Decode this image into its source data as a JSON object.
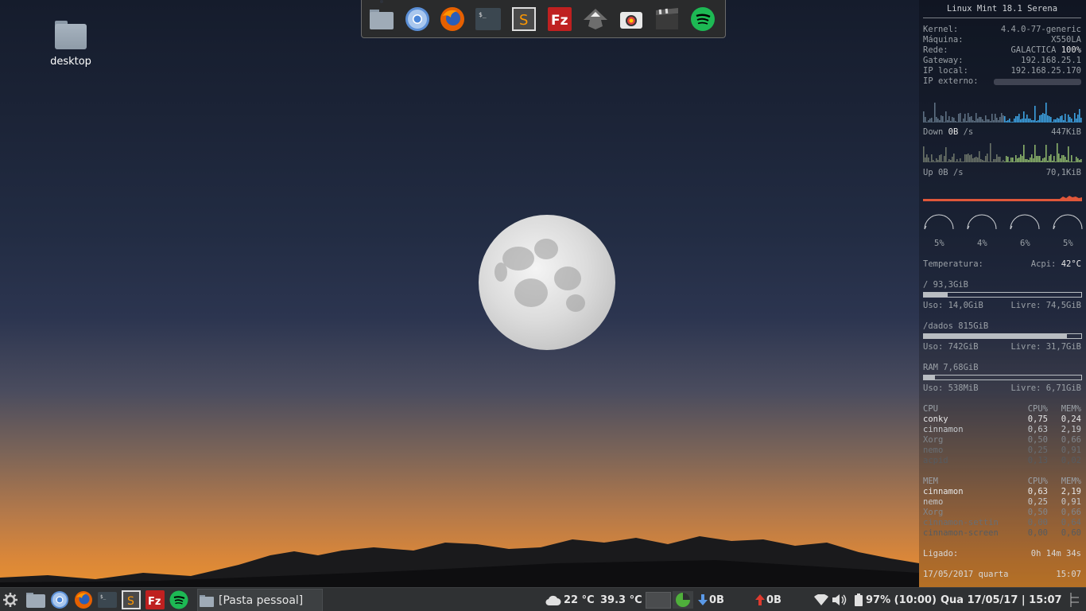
{
  "desktop": {
    "icon_label": "desktop"
  },
  "dock": {
    "items": [
      "files-icon",
      "chromium-icon",
      "firefox-icon",
      "terminal-icon",
      "sublime-text-icon",
      "filezilla-icon",
      "inkscape-icon",
      "screenshot-icon",
      "video-editor-icon",
      "spotify-icon"
    ]
  },
  "conky": {
    "title": "Linux Mint 18.1 Serena",
    "system": [
      {
        "label": "Kernel:",
        "value": "4.4.0-77-generic"
      },
      {
        "label": "Máquina:",
        "value": "X550LA"
      },
      {
        "label": "Rede:",
        "value": "GALACTICA",
        "extra": "100%"
      },
      {
        "label": "Gateway:",
        "value": "192.168.25.1"
      },
      {
        "label": "IP local:",
        "value": "192.168.25.170"
      },
      {
        "label": "IP externo:",
        "value": ""
      }
    ],
    "down": {
      "label": "Down",
      "value": "0B",
      "unit": "/s",
      "max": "447KiB"
    },
    "up": {
      "label": "Up",
      "value": "0B",
      "unit": "/s",
      "max": "70,1KiB"
    },
    "cpu_gauges": [
      "5%",
      "4%",
      "6%",
      "5%"
    ],
    "temperature": {
      "label": "Temperatura:",
      "source": "Acpi:",
      "value": "42°C"
    },
    "disks": [
      {
        "name": "/",
        "size": "93,3GiB",
        "used": "Uso: 14,0GiB",
        "free": "Livre: 74,5GiB",
        "fill": 0.15
      },
      {
        "name": "/dados",
        "size": "815GiB",
        "used": "Uso: 742GiB",
        "free": "Livre: 31,7GiB",
        "fill": 0.91
      }
    ],
    "ram": {
      "name": "RAM",
      "size": "7,68GiB",
      "used": "Uso: 538MiB",
      "free": "Livre: 6,71GiB",
      "fill": 0.07
    },
    "cpu_table": {
      "header": [
        "CPU",
        "CPU%",
        "MEM%"
      ],
      "rows": [
        [
          "conky",
          "0,75",
          "0,24"
        ],
        [
          "cinnamon",
          "0,63",
          "2,19"
        ],
        [
          "Xorg",
          "0,50",
          "0,66"
        ],
        [
          "nemo",
          "0,25",
          "0,91"
        ],
        [
          "acpid",
          "0,13",
          "0,02"
        ]
      ]
    },
    "mem_table": {
      "header": [
        "MEM",
        "CPU%",
        "MEM%"
      ],
      "rows": [
        [
          "cinnamon",
          "0,63",
          "2,19"
        ],
        [
          "nemo",
          "0,25",
          "0,91"
        ],
        [
          "Xorg",
          "0,50",
          "0,66"
        ],
        [
          "cinnamon-settin",
          "0,00",
          "0,64"
        ],
        [
          "cinnamon-screen",
          "0,00",
          "0,60"
        ]
      ]
    },
    "uptime": {
      "label": "Ligado:",
      "value": "0h 14m 34s"
    },
    "datetime": {
      "date": "17/05/2017 quarta",
      "time": "15:07"
    }
  },
  "taskbar": {
    "window_title": "[Pasta pessoal]",
    "weather": "22 °C",
    "cpu_temp": "39.3 °C",
    "net_down": "0B",
    "net_up": "0B",
    "battery": "97% (10:00)",
    "clock": "Qua 17/05/17 | 15:07"
  }
}
